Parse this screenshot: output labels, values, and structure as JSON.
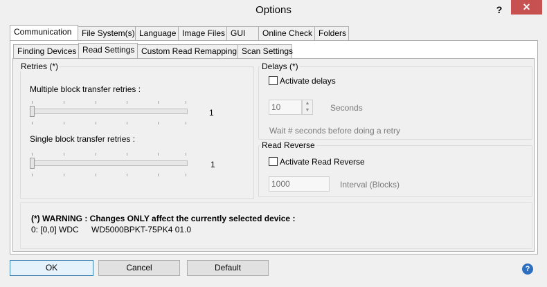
{
  "window": {
    "title": "Options",
    "help_glyph": "?",
    "close_glyph": "✕"
  },
  "main_tabs": [
    {
      "label": "Communication",
      "active": true
    },
    {
      "label": "File System(s)"
    },
    {
      "label": "Language"
    },
    {
      "label": "Image Files"
    },
    {
      "label": "GUI"
    },
    {
      "label": "Online Check"
    },
    {
      "label": "Folders"
    }
  ],
  "sub_tabs": [
    {
      "label": "Finding Devices"
    },
    {
      "label": "Read Settings",
      "active": true
    },
    {
      "label": "Custom Read Remapping"
    },
    {
      "label": "Scan Settings"
    }
  ],
  "retries": {
    "title": "Retries (*)",
    "multiple_label": "Multiple block transfer retries :",
    "multiple_value": "1",
    "single_label": "Single block transfer retries   :",
    "single_value": "1"
  },
  "delays": {
    "title": "Delays (*)",
    "checkbox_label": "Activate delays",
    "checked": false,
    "seconds_value": "10",
    "seconds_label": "Seconds",
    "note": "Wait # seconds before doing a retry"
  },
  "read_reverse": {
    "title": "Read Reverse",
    "checkbox_label": "Activate Read Reverse",
    "checked": false,
    "interval_value": "1000",
    "interval_label": "Interval (Blocks)"
  },
  "warning": {
    "text": "(*) WARNING : Changes ONLY affect the currently selected device :",
    "device_id": "0: [0,0]  WDC",
    "device_model": "WD5000BPKT-75PK4  01.0"
  },
  "buttons": {
    "ok": "OK",
    "cancel": "Cancel",
    "default": "Default",
    "help_glyph": "?"
  }
}
